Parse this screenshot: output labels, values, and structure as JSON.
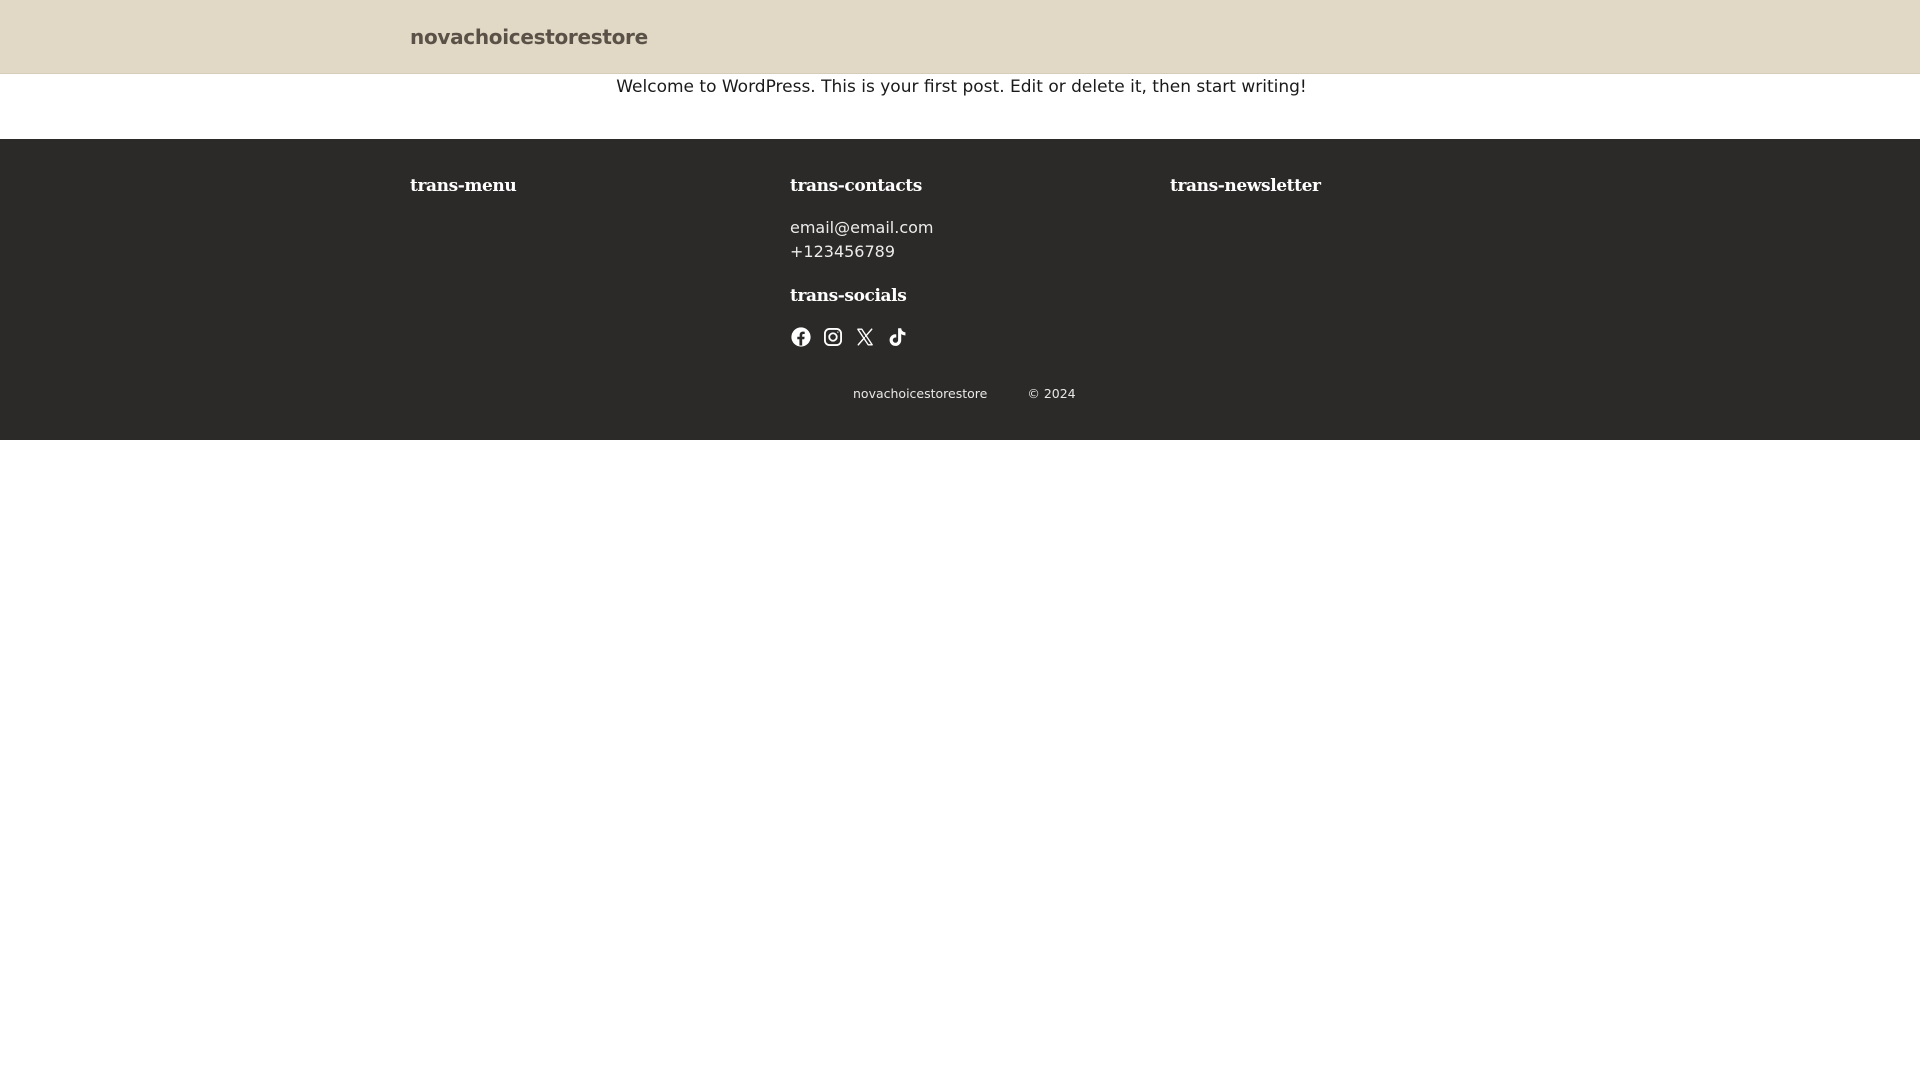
{
  "header": {
    "site_title": "novachoicestorestore"
  },
  "post": {
    "text": "Welcome to WordPress. This is your first post. Edit or delete it, then start writing!"
  },
  "footer": {
    "menu_heading": "trans-menu",
    "contacts_heading": "trans-contacts",
    "newsletter_heading": "trans-newsletter",
    "socials_heading": "trans-socials",
    "email": "email@email.com",
    "phone": "+123456789",
    "socials": [
      "facebook-icon",
      "instagram-icon",
      "x-icon",
      "tiktok-icon"
    ],
    "bottom_site_name": "novachoicestorestore",
    "copyright": "© 2024"
  },
  "colors": {
    "header_bg": "#e2d8c6",
    "footer_bg": "#2c2a28"
  }
}
